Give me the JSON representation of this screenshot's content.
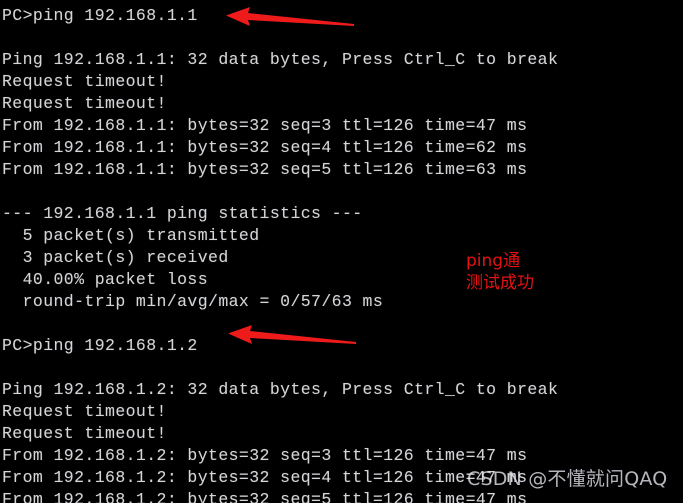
{
  "terminal": {
    "background_color": "#000000",
    "text_color": "#d6d6d6",
    "lines": [
      "PC>ping 192.168.1.1",
      "",
      "Ping 192.168.1.1: 32 data bytes, Press Ctrl_C to break",
      "Request timeout!",
      "Request timeout!",
      "From 192.168.1.1: bytes=32 seq=3 ttl=126 time=47 ms",
      "From 192.168.1.1: bytes=32 seq=4 ttl=126 time=62 ms",
      "From 192.168.1.1: bytes=32 seq=5 ttl=126 time=63 ms",
      "",
      "--- 192.168.1.1 ping statistics ---",
      "  5 packet(s) transmitted",
      "  3 packet(s) received",
      "  40.00% packet loss",
      "  round-trip min/avg/max = 0/57/63 ms",
      "",
      "PC>ping 192.168.1.2",
      "",
      "Ping 192.168.1.2: 32 data bytes, Press Ctrl_C to break",
      "Request timeout!",
      "Request timeout!",
      "From 192.168.1.2: bytes=32 seq=3 ttl=126 time=47 ms",
      "From 192.168.1.2: bytes=32 seq=4 ttl=126 time=47 ms",
      "From 192.168.1.2: bytes=32 seq=5 ttl=126 time=47 ms"
    ]
  },
  "annotations": {
    "color": "#e51212",
    "ping_ok": "ping通",
    "test_ok": "测试成功",
    "arrow_1_name": "red-arrow-pointing-to-first-ping-command",
    "arrow_2_name": "red-arrow-pointing-to-second-ping-command"
  },
  "watermark": {
    "text": "CSDN @不懂就问QAQ"
  }
}
